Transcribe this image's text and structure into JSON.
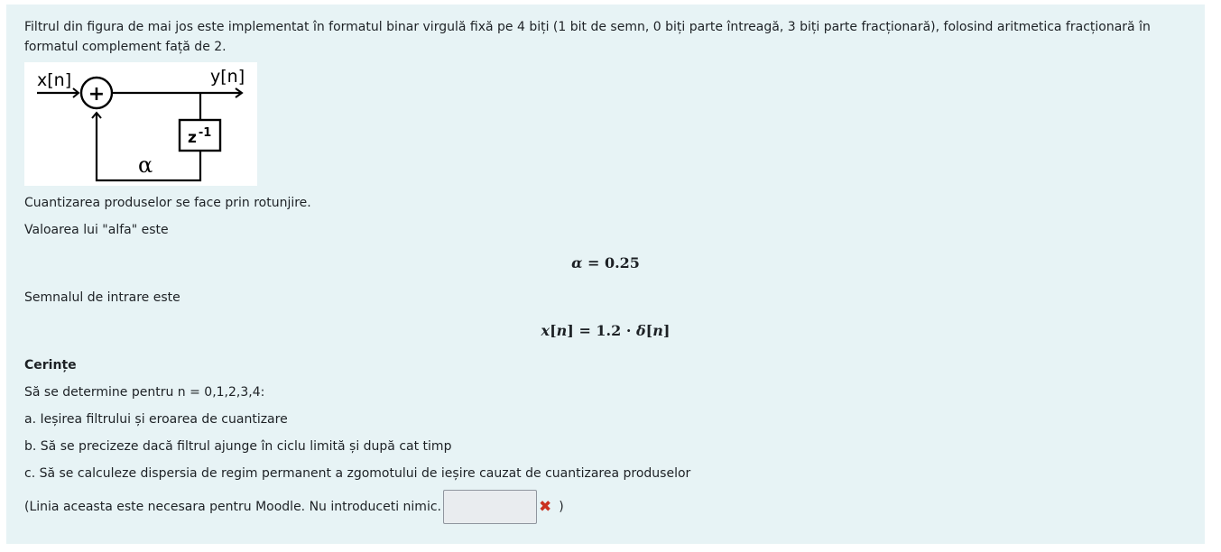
{
  "question": {
    "intro": "Filtrul din figura de mai jos este implementat în formatul binar virgulă fixă pe 4 biți (1 bit de semn, 0 biți parte întreagă, 3 biți parte fracționară), folosind aritmetica fracționară în formatul complement față de 2.",
    "diagram": {
      "input_label": "x[n]",
      "output_label": "y[n]",
      "adder_symbol": "+",
      "delay_label": "z",
      "delay_exponent": "-1",
      "coef_label": "α"
    },
    "quantization_text": "Cuantizarea produselor se face prin rotunjire.",
    "alpha_text": "Valoarea lui \"alfa\" este",
    "alpha_eq": {
      "lhs": "α",
      "op": "=",
      "rhs": "0.25"
    },
    "input_text": "Semnalul de intrare este",
    "input_eq": {
      "x": "x",
      "n1": "n",
      "op": "=",
      "coef": "1.2",
      "dot": "·",
      "delta": "δ",
      "n2": "n"
    },
    "requirements_heading": "Cerințe",
    "determine_text": "Să se determine pentru n = 0,1,2,3,4:",
    "items": [
      "a. Ieșirea filtrului și eroarea de cuantizare",
      "b. Să se precizeze dacă filtrul ajunge în ciclu limită și după cat timp",
      "c. Să se calculeze dispersia de regim permanent a zgomotului de ieșire cauzat de cuantizarea produselor"
    ],
    "moodle_line": "(Linia aceasta este necesara pentru Moodle. Nu introduceti nimic.",
    "moodle_input_value": "",
    "closing_paren": ")"
  },
  "colors": {
    "panel_bg": "#e7f3f5",
    "error_icon": "#ca3120"
  }
}
